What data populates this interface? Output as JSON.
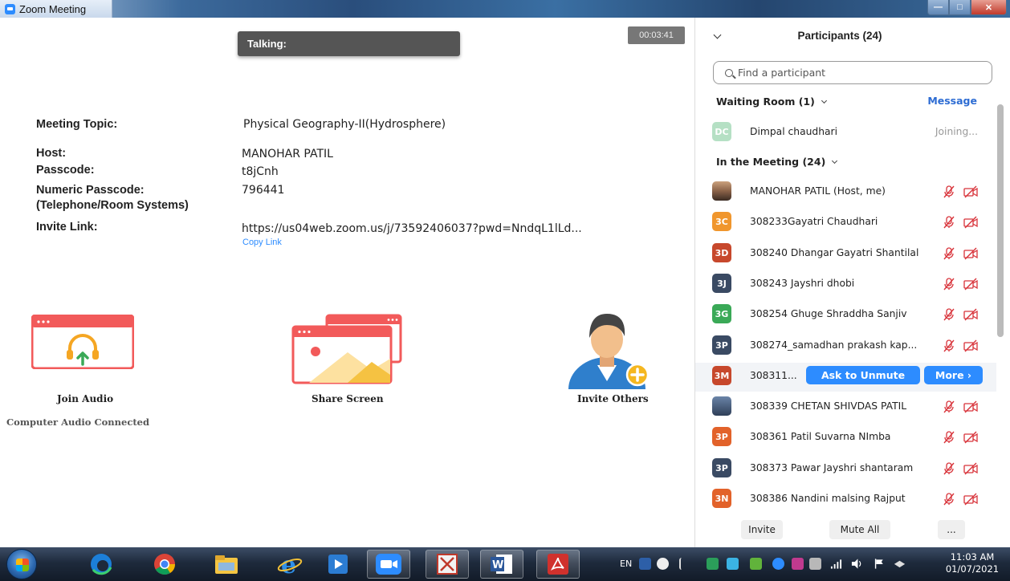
{
  "window": {
    "title": "Zoom Meeting"
  },
  "meeting": {
    "talking_label": "Talking:",
    "timer": "00:03:41",
    "labels": {
      "topic": "Meeting Topic:",
      "host": "Host:",
      "passcode": "Passcode:",
      "numeric_passcode_1": "Numeric Passcode:",
      "numeric_passcode_2": "(Telephone/Room Systems)",
      "invite_link": "Invite Link:"
    },
    "values": {
      "topic": "Physical Geography-II(Hydrosphere)",
      "host": "MANOHAR PATIL",
      "passcode": "t8jCnh",
      "numeric_passcode": "796441",
      "invite_link": "https://us04web.zoom.us/j/73592406037?pwd=NndqL1lLd..."
    },
    "copy_link": "Copy Link",
    "actions": {
      "join_audio": "Join Audio",
      "audio_status": "Computer Audio Connected",
      "share_screen": "Share Screen",
      "invite_others": "Invite Others"
    }
  },
  "participants_panel": {
    "title": "Participants (24)",
    "search_placeholder": "Find a participant",
    "waiting_room": {
      "heading": "Waiting Room (1)",
      "message_label": "Message",
      "entries": [
        {
          "initials": "DC",
          "name": "Dimpal chaudhari",
          "status": "Joining...",
          "color": "#b5e0c4"
        }
      ]
    },
    "in_meeting": {
      "heading": "In the Meeting (24)",
      "entries": [
        {
          "initials": "",
          "name": "MANOHAR PATIL (Host, me)",
          "avatar": "photo"
        },
        {
          "initials": "3C",
          "name": "308233Gayatri Chaudhari",
          "color": "#f0962d"
        },
        {
          "initials": "3D",
          "name": "308240 Dhangar Gayatri Shantilal",
          "color": "#c7482c"
        },
        {
          "initials": "3J",
          "name": "308243 Jayshri dhobi",
          "color": "#3a4a63"
        },
        {
          "initials": "3G",
          "name": "308254 Ghuge Shraddha Sanjiv",
          "color": "#3aa957"
        },
        {
          "initials": "3P",
          "name": "308274_samadhan prakash kap...",
          "color": "#3a4a63"
        },
        {
          "initials": "3M",
          "name": "308311...",
          "color": "#c7482c",
          "highlight": true
        },
        {
          "initials": "",
          "name": "308339 CHETAN SHIVDAS PATIL",
          "avatar": "photo2"
        },
        {
          "initials": "3P",
          "name": "308361 Patil Suvarna NImba",
          "color": "#e2622a"
        },
        {
          "initials": "3P",
          "name": "308373 Pawar Jayshri shantaram",
          "color": "#3a4a63"
        },
        {
          "initials": "3N",
          "name": "308386 Nandini malsing Rajput",
          "color": "#e2622a"
        }
      ],
      "ask_to_unmute": "Ask to Unmute",
      "more": "More ›"
    },
    "footer": {
      "invite": "Invite",
      "mute_all": "Mute All",
      "more": "..."
    }
  },
  "taskbar": {
    "language": "EN",
    "time": "11:03 AM",
    "date": "01/07/2021"
  },
  "colors": {
    "accent": "#2d8cff",
    "muted_red": "#d8333a",
    "action_red": "#f25a5a",
    "action_orange": "#f5a623"
  }
}
